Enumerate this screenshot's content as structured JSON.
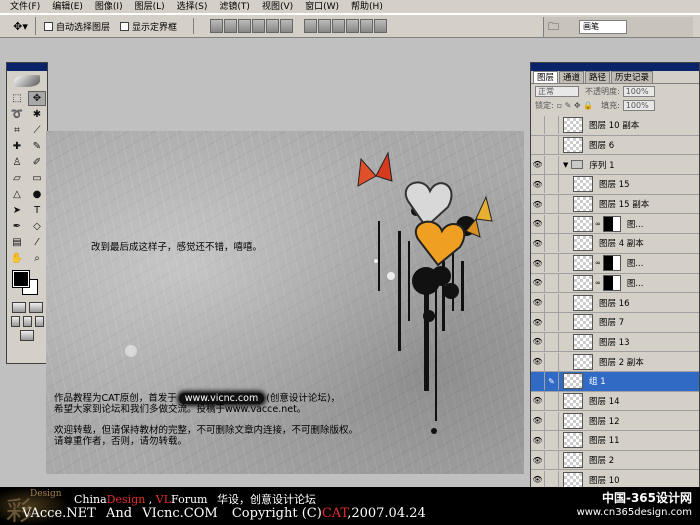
{
  "menubar": {
    "items": [
      "文件(F)",
      "编辑(E)",
      "图像(I)",
      "图层(L)",
      "选择(S)",
      "滤镜(T)",
      "视图(V)",
      "窗口(W)",
      "帮助(H)"
    ]
  },
  "options": {
    "auto_select": "自动选择图层",
    "show_bounds": "显示定界框",
    "brush_tab": "画笔"
  },
  "canvas": {
    "caption": "改到最后成这样子，感觉还不错，嘻嘻。",
    "credit_pre": "作品教程为CAT原创，首发于",
    "credit_url": "www.vicnc.com",
    "credit_post": "(创意设计论坛)，",
    "line2": "希望大家到论坛和我们多做交流。投稿于www.vacce.net。",
    "line3": "欢迎转载，但请保持教材的完整，不可删除文章内连接，不可删除版权。",
    "line4": "请尊重作者，否则，请勿转载。"
  },
  "layers_panel": {
    "tabs": [
      "图层",
      "通道",
      "路径",
      "历史记录"
    ],
    "blend_mode": "正常",
    "opacity_label": "不透明度:",
    "opacity_value": "100%",
    "lock_label": "锁定:",
    "fill_label": "填充:",
    "fill_value": "100%",
    "layers": [
      {
        "name": "图层 10 副本",
        "visible": false,
        "type": "layer"
      },
      {
        "name": "图层 6",
        "visible": false,
        "type": "layer"
      },
      {
        "name": "序列 1",
        "visible": true,
        "type": "group"
      },
      {
        "name": "图层 15",
        "visible": true,
        "type": "layer"
      },
      {
        "name": "图层 15 副本",
        "visible": true,
        "type": "layer"
      },
      {
        "name": "图...",
        "visible": true,
        "type": "masked"
      },
      {
        "name": "图层 4 副本",
        "visible": true,
        "type": "layer"
      },
      {
        "name": "图...",
        "visible": true,
        "type": "masked"
      },
      {
        "name": "图...",
        "visible": true,
        "type": "masked"
      },
      {
        "name": "图层 16",
        "visible": true,
        "type": "layer"
      },
      {
        "name": "图层 7",
        "visible": true,
        "type": "layer"
      },
      {
        "name": "图层 13",
        "visible": true,
        "type": "layer"
      },
      {
        "name": "图层 2 副本",
        "visible": true,
        "type": "layer"
      },
      {
        "name": "组 1",
        "visible": false,
        "type": "selected"
      },
      {
        "name": "图层 14",
        "visible": true,
        "type": "layer"
      },
      {
        "name": "图层 12",
        "visible": true,
        "type": "layer"
      },
      {
        "name": "图层 11",
        "visible": true,
        "type": "layer"
      },
      {
        "name": "图层 2",
        "visible": true,
        "type": "layer"
      },
      {
        "name": "图层 10",
        "visible": true,
        "type": "layer"
      }
    ]
  },
  "footer": {
    "logo_text": "Design",
    "china": "China",
    "design": "Design",
    "vl": "VL",
    "forum": "Forum",
    "cn_tag": "华设，创意设计论坛",
    "vacce": "VAcce.NET",
    "and": "And",
    "vicnc": "VIcnc.COM",
    "copyright": "Copyright (C)",
    "cat": "CAT",
    "date": ",2007.04.24",
    "site_cn": "中国-365设计网",
    "site_en": "www.cn365design.com"
  },
  "colors": {
    "selection": "#316ac5",
    "title_bar": "#0a246a",
    "accent_red": "#e03030",
    "heart_silver": "#d0d0d0",
    "heart_gold": "#f0a020"
  }
}
